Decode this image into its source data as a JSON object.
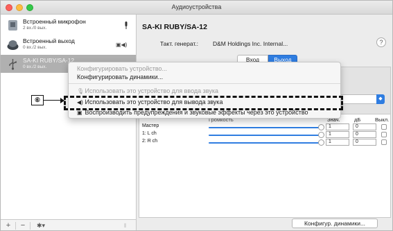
{
  "window": {
    "title": "Аудиоустройства"
  },
  "devices": [
    {
      "name": "Встроенный микрофон",
      "sub": "2 вх./0 вых.",
      "icon": "microphone-icon"
    },
    {
      "name": "Встроенный выход",
      "sub": "0 вх./2 вых.",
      "icon": "speaker-icon"
    },
    {
      "name": "SA-KI RUBY/SA-12",
      "sub": "0 вх./2 вых.",
      "icon": "usb-icon"
    }
  ],
  "sidebar_bottom": {
    "add": "+",
    "remove": "−",
    "gear": "✱▾"
  },
  "detail": {
    "device_title": "SA-KI RUBY/SA-12",
    "clock_label": "Такт. генерат.:",
    "clock_value": "D&M Holdings Inc. Internal...",
    "help": "?",
    "tabs": [
      "Вход",
      "Выход"
    ],
    "active_tab": "Выход"
  },
  "grid": {
    "headers": {
      "value": "Знач.",
      "db": "дБ",
      "mute": "Выкл."
    },
    "rows": [
      {
        "label": "Мастер",
        "value": "1",
        "db": "0"
      },
      {
        "label": "1: L ch",
        "value": "1",
        "db": "0"
      },
      {
        "label": "2: R ch",
        "value": "1",
        "db": "0"
      }
    ],
    "header_partial": "Громкость"
  },
  "config_button": "Конфигур. динамики...",
  "context_menu": [
    {
      "label": "Конфигурировать устройство...",
      "enabled": false
    },
    {
      "label": "Конфигурировать динамики...",
      "enabled": true
    },
    {
      "label": "Использовать это устройство для ввода звука",
      "enabled": false,
      "icon": "microphone-icon"
    },
    {
      "label": "Использовать это устройство для вывода звука",
      "enabled": true,
      "icon": "speaker-icon"
    },
    {
      "label": "Воспроизводить предупреждения и звуковые эффекты через это устройство",
      "enabled": true,
      "icon": "alert-icon"
    }
  ],
  "callout": {
    "number": "⑥"
  },
  "colors": {
    "accent": "#2f7de1",
    "selection": "#b0b0b0"
  }
}
